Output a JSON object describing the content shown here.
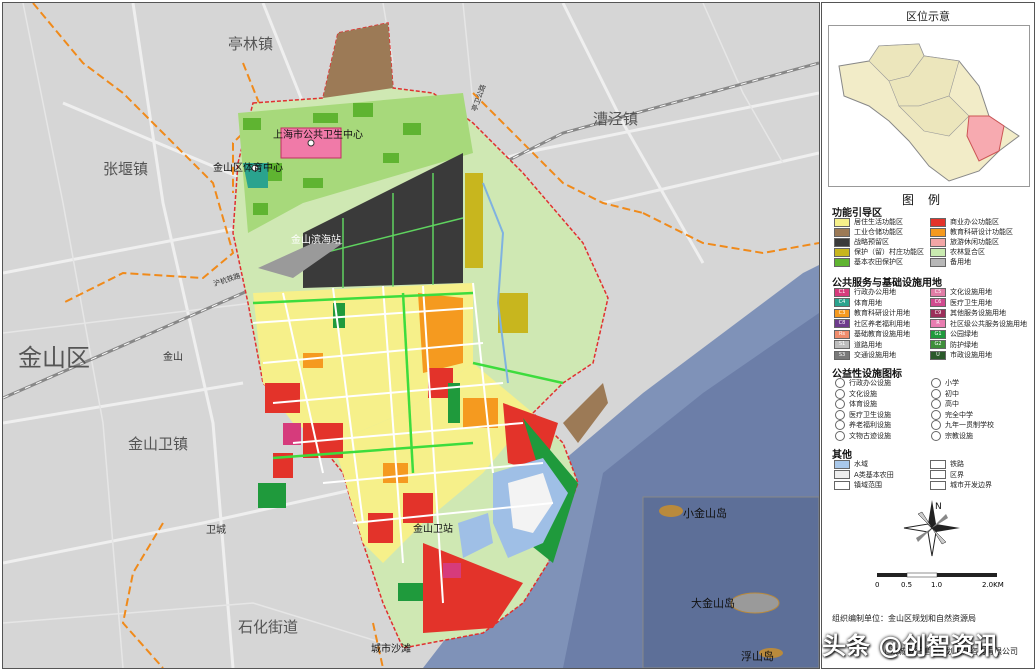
{
  "map": {
    "towns": {
      "tinglin": "亭林镇",
      "caojing": "漕泾镇",
      "zhangyan": "张堰镇",
      "jinshan_district": "金山区",
      "jinshan_town": "金山",
      "jinshanwei_town": "金山卫镇",
      "weicheng": "卫城",
      "shihua": "石化街道"
    },
    "places": {
      "health_center": "上海市公共卫生中心",
      "sports_center": "金山区体育中心",
      "binhai_station": "金山滨海站",
      "wei_station": "金山卫站",
      "beach": "城市沙滩",
      "railway": "沪杭铁路",
      "zhuxin_road": "亭卫公路"
    },
    "islands": {
      "small": "小金山岛",
      "big": "大金山岛",
      "fu": "浮山岛"
    }
  },
  "side": {
    "inset_title": "区位示意",
    "legend_title": "图例",
    "sections": {
      "function": "功能引导区",
      "public": "公共服务与基础设施用地",
      "icons": "公益性设施图标",
      "other": "其他"
    },
    "function_items": [
      {
        "label": "居住生活功能区",
        "color": "#f6f08a"
      },
      {
        "label": "商业办公功能区",
        "color": "#e3332a"
      },
      {
        "label": "工业仓储功能区",
        "color": "#9c7a56"
      },
      {
        "label": "教育科研设计功能区",
        "color": "#f59a1f"
      },
      {
        "label": "战略预留区",
        "color": "#3a3a3a"
      },
      {
        "label": "旅游休闲功能区",
        "color": "#f2a6a6"
      },
      {
        "label": "保护（留）村庄功能区",
        "color": "#c8b61e"
      },
      {
        "label": "农林复合区",
        "color": "#c9ebb0"
      },
      {
        "label": "基本农田保护区",
        "color": "#5fb431"
      },
      {
        "label": "备用地",
        "color": "#b8b8b8"
      }
    ],
    "public_items": [
      {
        "code": "C1",
        "label": "行政办公用地",
        "color": "#d63b7c"
      },
      {
        "code": "C5",
        "label": "文化设施用地",
        "color": "#e07da6"
      },
      {
        "code": "C4",
        "label": "体育用地",
        "color": "#2aa38e"
      },
      {
        "code": "C6",
        "label": "医疗卫生用地",
        "color": "#d14b8f"
      },
      {
        "code": "C3",
        "label": "教育科研设计用地",
        "color": "#f59a1f"
      },
      {
        "code": "C9",
        "label": "其他服务设施用地",
        "color": "#9b2f5a"
      },
      {
        "code": "C8",
        "label": "社区养老福利用地",
        "color": "#6d3a8c"
      },
      {
        "code": "R",
        "label": "社区级公共服务设施用地",
        "color": "#e87db0"
      },
      {
        "code": "Rs",
        "label": "基础教育设施用地",
        "color": "#f08c6c"
      },
      {
        "code": "G1",
        "label": "公园绿地",
        "color": "#1f9a3c"
      },
      {
        "code": "S1",
        "label": "道路用地",
        "color": "#bdbdbd"
      },
      {
        "code": "G2",
        "label": "防护绿地",
        "color": "#3e8f3a"
      },
      {
        "code": "S3",
        "label": "交通设施用地",
        "color": "#7a7a7a"
      },
      {
        "code": "U",
        "label": "市政设施用地",
        "color": "#2a5a2a"
      }
    ],
    "icon_items": [
      {
        "label": "行政办公设施",
        "col": 0
      },
      {
        "label": "小学",
        "col": 1
      },
      {
        "label": "文化设施",
        "col": 0
      },
      {
        "label": "初中",
        "col": 1
      },
      {
        "label": "体育设施",
        "col": 0
      },
      {
        "label": "高中",
        "col": 1
      },
      {
        "label": "医疗卫生设施",
        "col": 0
      },
      {
        "label": "完全中学",
        "col": 1
      },
      {
        "label": "养老福利设施",
        "col": 0
      },
      {
        "label": "九年一贯制学校",
        "col": 1
      },
      {
        "label": "文物古迹设施",
        "col": 0
      },
      {
        "label": "宗教设施",
        "col": 1
      }
    ],
    "other_items": [
      {
        "label": "水域",
        "color": "#a9c8ea"
      },
      {
        "label": "铁路",
        "color": "#ffffff"
      },
      {
        "label": "A类基本农田",
        "color": "#eeeeee"
      },
      {
        "label": "区界",
        "color": "#ffffff"
      },
      {
        "label": "镇域范围",
        "color": "#ffffff"
      },
      {
        "label": "城市开发边界",
        "color": "#ffffff"
      }
    ],
    "compass_letter": "N",
    "scale": {
      "s0": "0",
      "s1": "0.5",
      "s2": "1.0",
      "s3": "2.0KM"
    },
    "org": {
      "line1": "组织编制单位：金山区规划和自然资源局",
      "line2": "上海城策行建筑规划设计咨询有限公司"
    }
  },
  "watermark": "头条 @创智资讯"
}
